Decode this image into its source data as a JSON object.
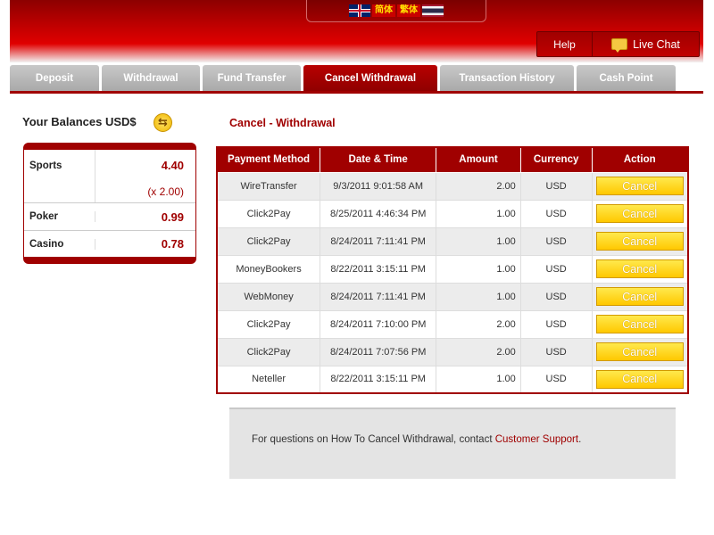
{
  "header": {
    "languages": [
      {
        "name": "english-flag",
        "label": ""
      },
      {
        "name": "simplified-chinese",
        "label": "简体"
      },
      {
        "name": "traditional-chinese",
        "label": "繁体"
      },
      {
        "name": "thai-flag",
        "label": ""
      }
    ],
    "help_label": "Help",
    "live_chat_label": "Live Chat"
  },
  "tabs": [
    {
      "label": "Deposit",
      "active": false
    },
    {
      "label": "Withdrawal",
      "active": false
    },
    {
      "label": "Fund Transfer",
      "active": false
    },
    {
      "label": "Cancel Withdrawal",
      "active": true
    },
    {
      "label": "Transaction History",
      "active": false
    },
    {
      "label": "Cash Point",
      "active": false
    }
  ],
  "balances": {
    "title": "Your Balances USD$",
    "sports_label": "Sports",
    "sports_value": "4.40",
    "sports_multiplier": "(x 2.00)",
    "poker_label": "Poker",
    "poker_value": "0.99",
    "casino_label": "Casino",
    "casino_value": "0.78"
  },
  "main": {
    "title": "Cancel - Withdrawal",
    "columns": [
      "Payment Method",
      "Date & Time",
      "Amount",
      "Currency",
      "Action"
    ],
    "rows": [
      {
        "method": "WireTransfer",
        "datetime": "9/3/2011 9:01:58 AM",
        "amount": "2.00",
        "currency": "USD",
        "action": "Cancel"
      },
      {
        "method": "Click2Pay",
        "datetime": "8/25/2011 4:46:34 PM",
        "amount": "1.00",
        "currency": "USD",
        "action": "Cancel"
      },
      {
        "method": "Click2Pay",
        "datetime": "8/24/2011 7:11:41 PM",
        "amount": "1.00",
        "currency": "USD",
        "action": "Cancel"
      },
      {
        "method": "MoneyBookers",
        "datetime": "8/22/2011 3:15:11 PM",
        "amount": "1.00",
        "currency": "USD",
        "action": "Cancel"
      },
      {
        "method": "WebMoney",
        "datetime": "8/24/2011 7:11:41 PM",
        "amount": "1.00",
        "currency": "USD",
        "action": "Cancel"
      },
      {
        "method": "Click2Pay",
        "datetime": "8/24/2011 7:10:00 PM",
        "amount": "2.00",
        "currency": "USD",
        "action": "Cancel"
      },
      {
        "method": "Click2Pay",
        "datetime": "8/24/2011 7:07:56 PM",
        "amount": "2.00",
        "currency": "USD",
        "action": "Cancel"
      },
      {
        "method": "Neteller",
        "datetime": "8/22/2011 3:15:11 PM",
        "amount": "1.00",
        "currency": "USD",
        "action": "Cancel"
      }
    ]
  },
  "footer": {
    "text": "For questions on How To Cancel Withdrawal, contact ",
    "link": "Customer Support",
    "end": "."
  },
  "colors": {
    "brand_red": "#a00000",
    "button_yellow": "#ffd400"
  }
}
